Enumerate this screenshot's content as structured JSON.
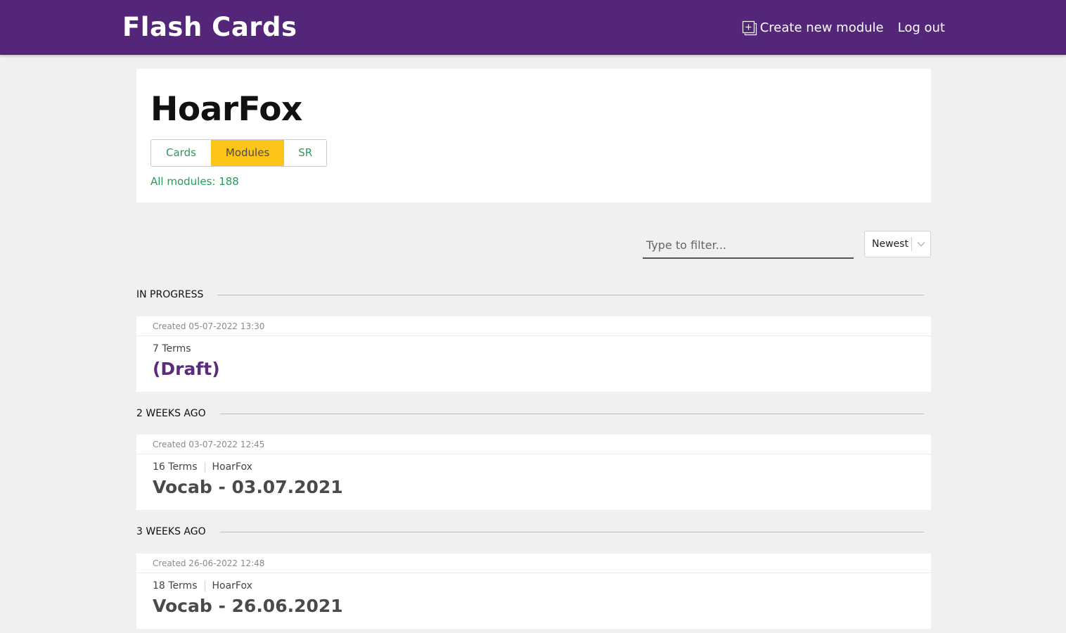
{
  "header": {
    "logo": "Flash Cards",
    "nav": {
      "create_icon": "add-box-icon",
      "create_label": "Create new module",
      "logout_label": "Log out"
    }
  },
  "profile": {
    "name": "HoarFox",
    "tabs": [
      {
        "label": "Cards",
        "active": false
      },
      {
        "label": "Modules",
        "active": true
      },
      {
        "label": "SR",
        "active": false
      }
    ],
    "all_modules": "All modules: 188"
  },
  "toolbar": {
    "filter_placeholder": "Type to filter...",
    "sort_value": "Newest",
    "sort_icon": "chevron-down-icon"
  },
  "sections": [
    {
      "label": "IN PROGRESS",
      "modules": [
        {
          "created": "Created 05-07-2022 13:30",
          "terms": "7 Terms",
          "author": "",
          "title": "(Draft)"
        }
      ]
    },
    {
      "label": "2 WEEKS AGO",
      "modules": [
        {
          "created": "Created 03-07-2022 12:45",
          "terms": "16 Terms",
          "author": "HoarFox",
          "title": "Vocab - 03.07.2021"
        }
      ]
    },
    {
      "label": "3 WEEKS AGO",
      "modules": [
        {
          "created": "Created 26-06-2022 12:48",
          "terms": "18 Terms",
          "author": "HoarFox",
          "title": "Vocab - 26.06.2021"
        }
      ]
    }
  ],
  "colors": {
    "header_bg": "#53267a",
    "accent_green": "#2a9a58",
    "active_tab": "#fcc419",
    "draft_title": "#5a2c7e",
    "page_bg": "#f0f0f0"
  }
}
